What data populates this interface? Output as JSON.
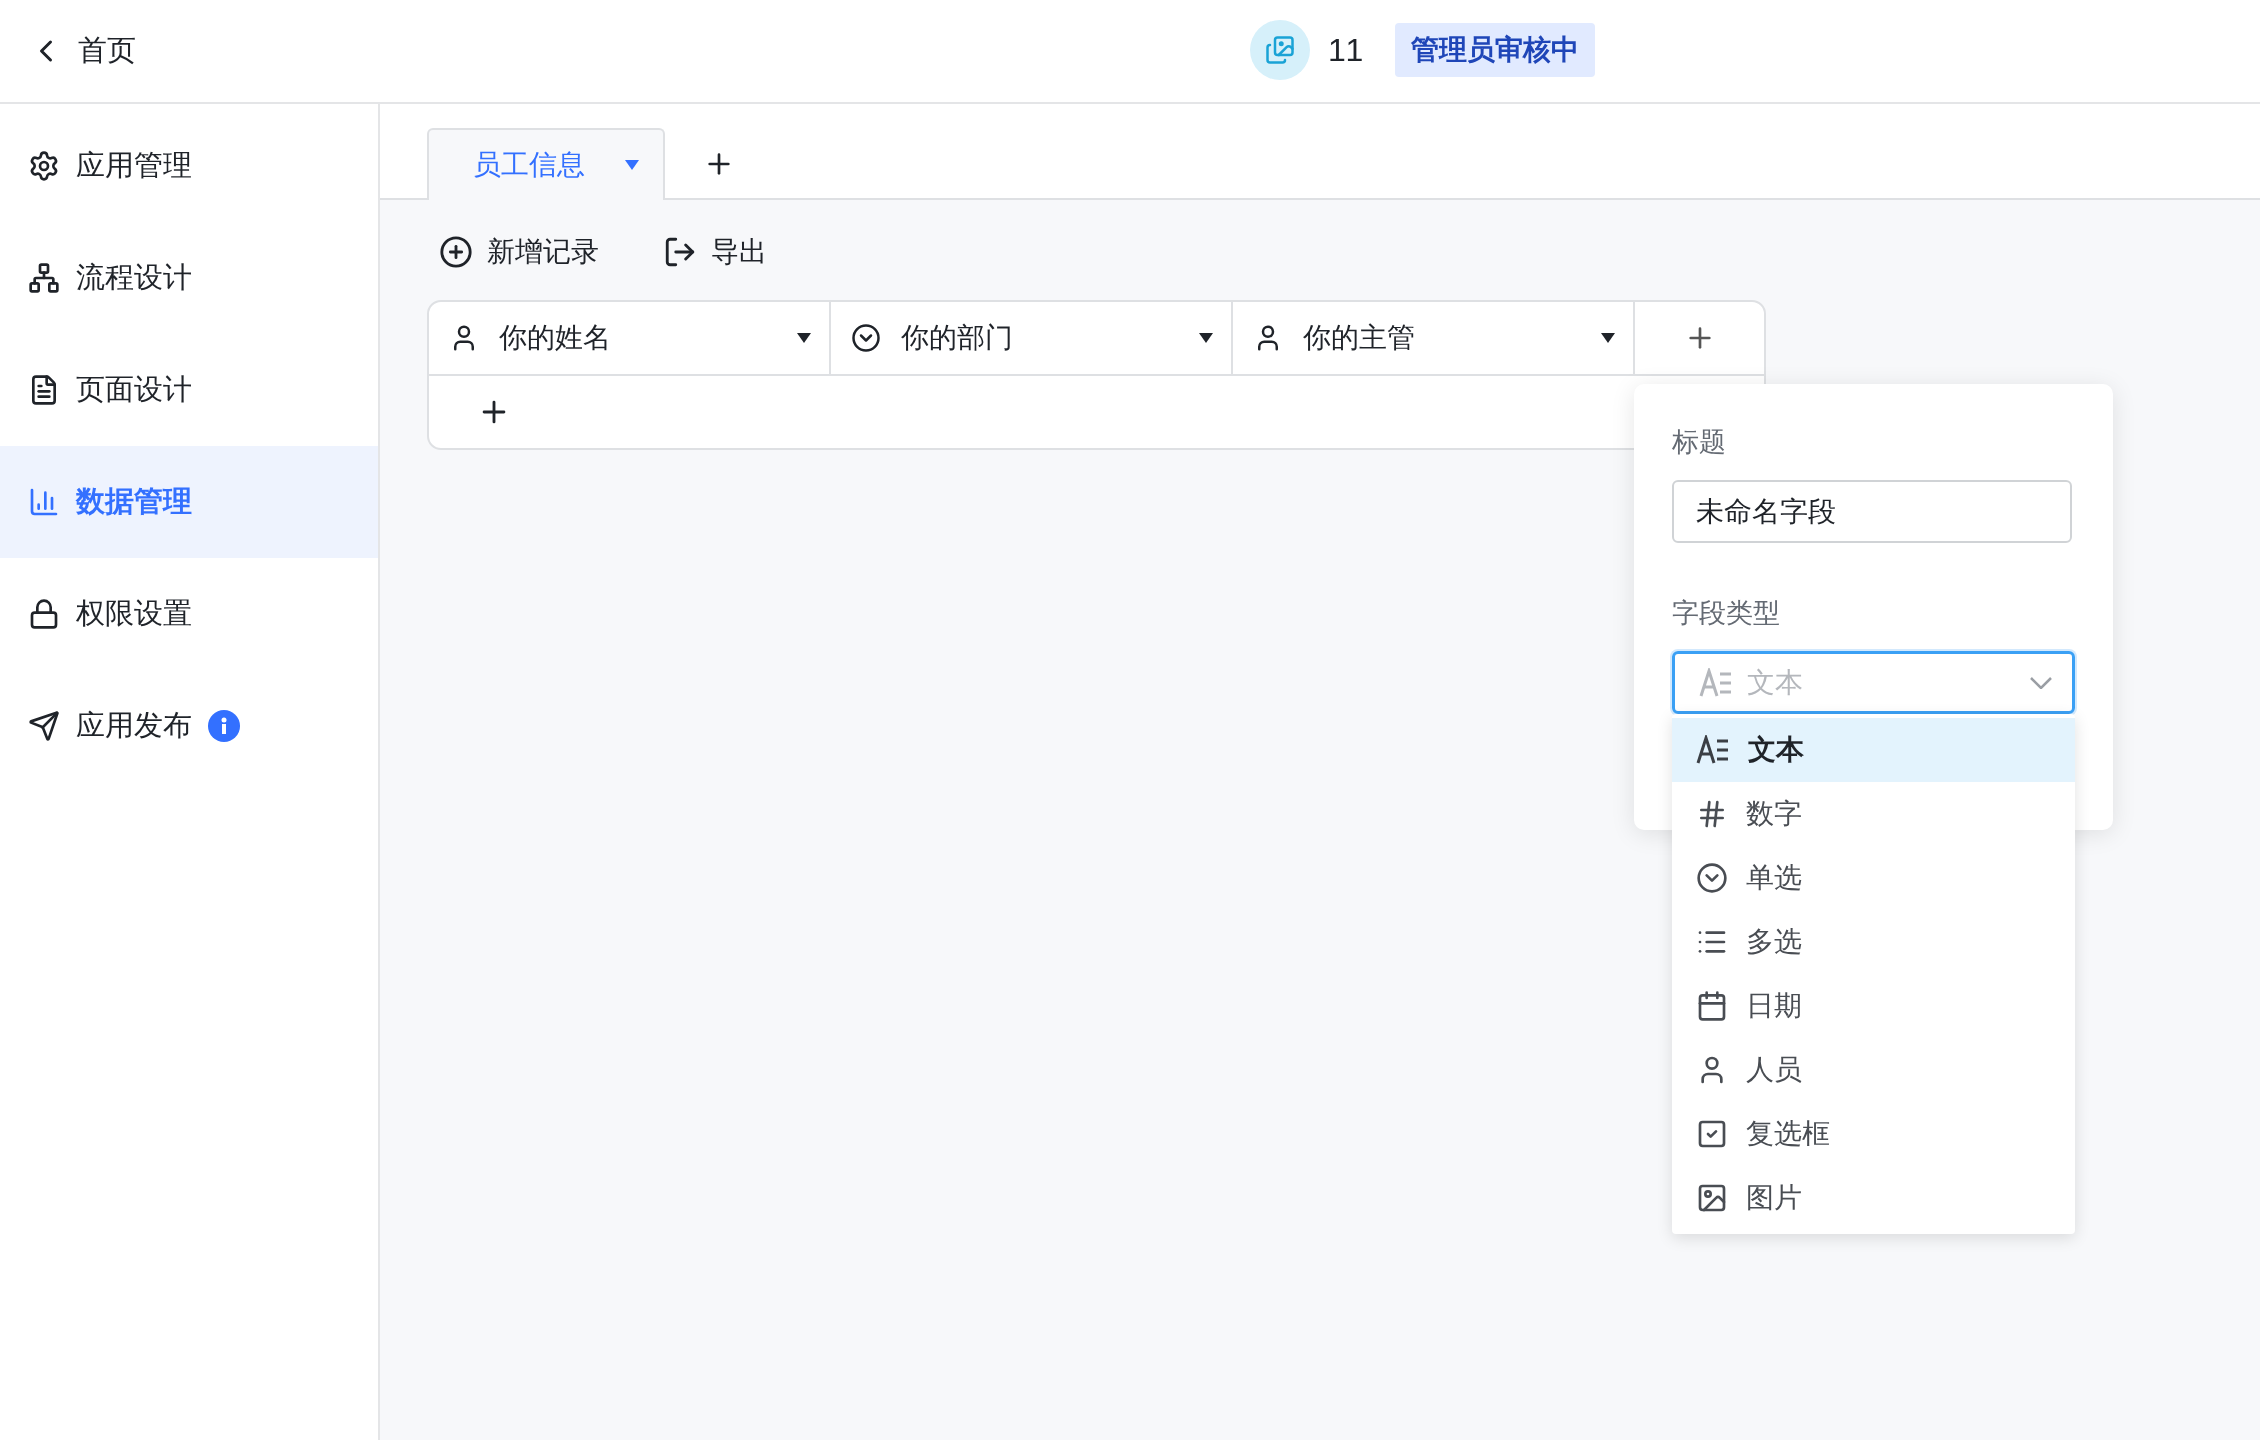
{
  "header": {
    "back_label": "首页",
    "count": "11",
    "status_badge": "管理员审核中"
  },
  "sidebar": {
    "items": [
      {
        "label": "应用管理",
        "kind": "settings",
        "selected": false,
        "info_badge": false
      },
      {
        "label": "流程设计",
        "kind": "flow",
        "selected": false,
        "info_badge": false
      },
      {
        "label": "页面设计",
        "kind": "page",
        "selected": false,
        "info_badge": false
      },
      {
        "label": "数据管理",
        "kind": "chart",
        "selected": true,
        "info_badge": false
      },
      {
        "label": "权限设置",
        "kind": "lock",
        "selected": false,
        "info_badge": false
      },
      {
        "label": "应用发布",
        "kind": "send",
        "selected": false,
        "info_badge": true
      }
    ]
  },
  "tabs": [
    {
      "label": "员工信息",
      "selected": true
    }
  ],
  "toolbar": [
    {
      "label": "新增记录",
      "kind": "add"
    },
    {
      "label": "导出",
      "kind": "export"
    }
  ],
  "table": {
    "columns": [
      {
        "label": "你的姓名",
        "kind": "person"
      },
      {
        "label": "你的部门",
        "kind": "single"
      },
      {
        "label": "你的主管",
        "kind": "person"
      }
    ]
  },
  "field_panel": {
    "title_label": "标题",
    "title_value": "未命名字段",
    "type_label": "字段类型",
    "type_placeholder": "文本",
    "type_options": [
      {
        "label": "文本",
        "kind": "text",
        "selected": true
      },
      {
        "label": "数字",
        "kind": "number",
        "selected": false
      },
      {
        "label": "单选",
        "kind": "single",
        "selected": false
      },
      {
        "label": "多选",
        "kind": "multi",
        "selected": false
      },
      {
        "label": "日期",
        "kind": "date",
        "selected": false
      },
      {
        "label": "人员",
        "kind": "person",
        "selected": false
      },
      {
        "label": "复选框",
        "kind": "checkbox",
        "selected": false
      },
      {
        "label": "图片",
        "kind": "image",
        "selected": false
      }
    ]
  }
}
